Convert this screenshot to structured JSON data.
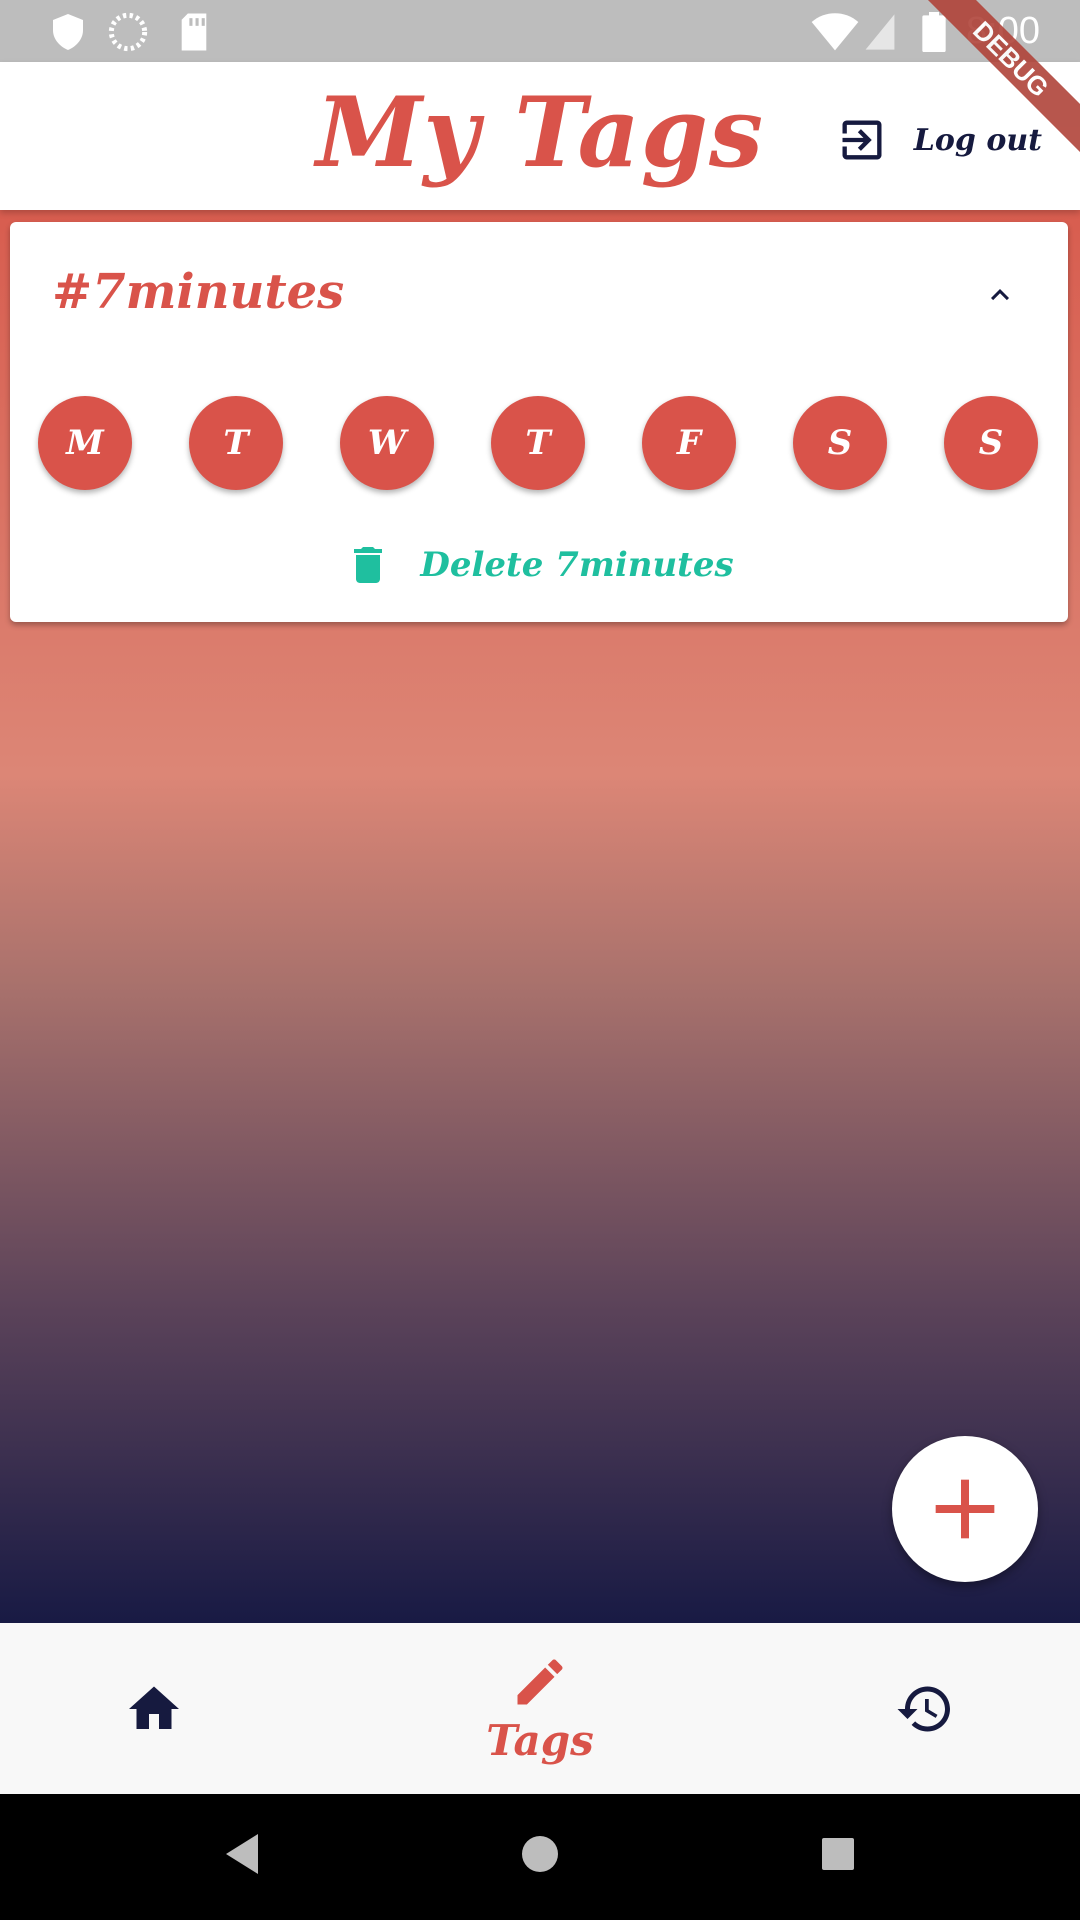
{
  "status_bar": {
    "time": "8:00",
    "icons": [
      "shield-icon",
      "sync-icon",
      "sd-card-icon",
      "wifi-icon",
      "signal-icon",
      "battery-icon"
    ]
  },
  "debug_ribbon": "DEBUG",
  "app_bar": {
    "title": "My Tags",
    "logout_label": "Log out",
    "logout_icon": "logout-icon"
  },
  "tag_card": {
    "title": "#7minutes",
    "expanded": true,
    "days": [
      "M",
      "T",
      "W",
      "T",
      "F",
      "S",
      "S"
    ],
    "delete_label": "Delete 7minutes",
    "delete_icon": "trash-icon"
  },
  "fab": {
    "icon": "plus-icon"
  },
  "bottom_nav": {
    "items": [
      {
        "icon": "home-icon",
        "label": ""
      },
      {
        "icon": "pencil-icon",
        "label": "Tags",
        "active": true
      },
      {
        "icon": "history-icon",
        "label": ""
      }
    ]
  },
  "colors": {
    "primary": "#d9534a",
    "navy": "#161a3f",
    "teal": "#1fbf9f",
    "white": "#ffffff"
  }
}
